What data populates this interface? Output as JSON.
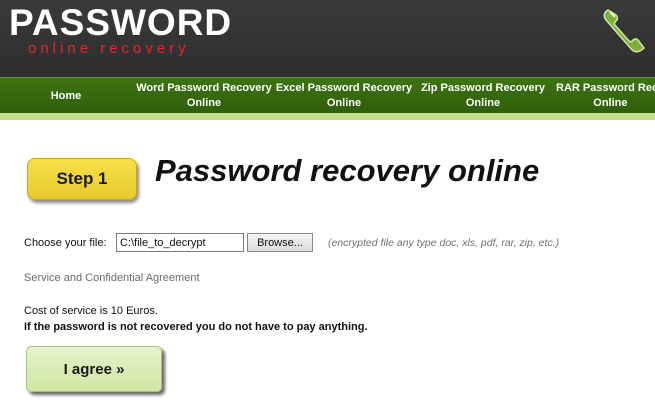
{
  "logo": {
    "title": "PASSWORD",
    "subtitle": "online recovery"
  },
  "icons": {
    "phone": "phone-icon"
  },
  "nav": {
    "items": [
      {
        "label": "Home"
      },
      {
        "label": "Word Password Recovery\nOnline"
      },
      {
        "label": "Excel Password Recovery\nOnline"
      },
      {
        "label": "Zip Password Recovery\nOnline"
      },
      {
        "label": "RAR Password Reco\nOnline"
      }
    ]
  },
  "step": {
    "label": "Step 1",
    "title": "Password recovery online"
  },
  "file": {
    "label": "Choose your file:",
    "value": "C:\\file_to_decrypt",
    "browse_label": "Browse...",
    "hint": "(encrypted file any type doc, xls, pdf, rar, zip, etc.)"
  },
  "agreement": {
    "link": "Service and Confidential Agreement",
    "cost": "Cost of service is 10 Euros.",
    "guarantee": "If the password is not recovered you do not have to pay anything.",
    "agree_label": "I agree »"
  },
  "colors": {
    "header_bg": "#333333",
    "nav_green": "#356a0e",
    "stripe": "#c5dc8e",
    "logo_red": "#e0262c",
    "step_yellow": "#f0d43a",
    "agree_green": "#d8ecb4"
  }
}
